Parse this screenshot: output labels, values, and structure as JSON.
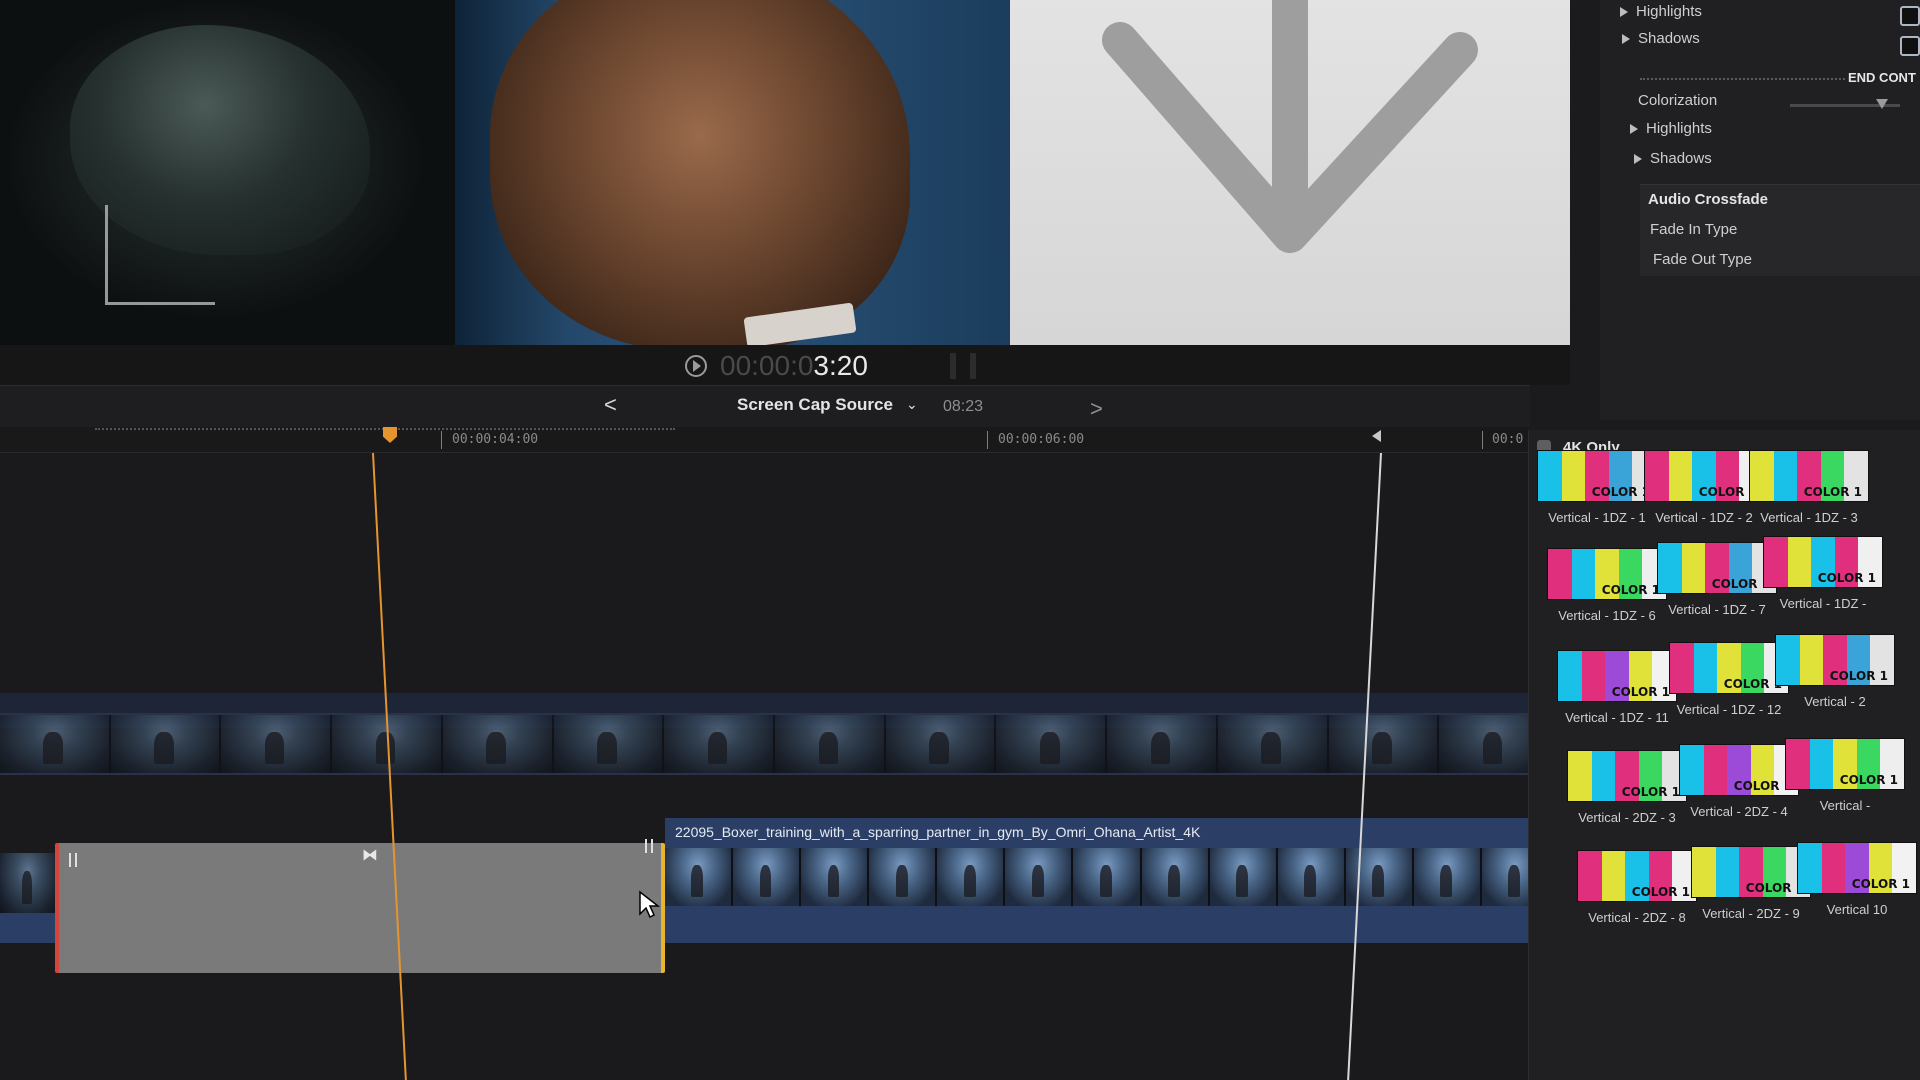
{
  "viewer": {
    "timecode_dim": "00:00:0",
    "timecode_bright": "3:20"
  },
  "inspector": {
    "rows": [
      "Highlights",
      "Shadows",
      "Colorization",
      "Highlights",
      "Shadows"
    ],
    "end_label": "END CONT",
    "audio_title": "Audio Crossfade",
    "fade_in": "Fade In Type",
    "fade_out": "Fade Out Type"
  },
  "timeline_header": {
    "project_name": "Screen Cap Source",
    "duration": "08:23",
    "prev": "<",
    "next": ">",
    "chevron": "⌄"
  },
  "ruler": {
    "labels": [
      "00:00:04:00",
      "00:00:06:00",
      "00:0"
    ]
  },
  "timeline": {
    "clip_name": "22095_Boxer_training_with_a_sparring_partner_in_gym_By_Omri_Ohana_Artist_4K"
  },
  "browser": {
    "filter_label": "4K Only",
    "thumb_text": "COLOR 1",
    "tiles": [
      {
        "name": "Vertical - 1DZ - 1"
      },
      {
        "name": "Vertical - 1DZ - 2"
      },
      {
        "name": "Vertical - 1DZ - 3"
      },
      {
        "name": "Vertical - 1DZ - 6"
      },
      {
        "name": "Vertical - 1DZ - 7"
      },
      {
        "name": "Vertical - 1DZ -"
      },
      {
        "name": "Vertical - 1DZ - 11"
      },
      {
        "name": "Vertical - 1DZ - 12"
      },
      {
        "name": "Vertical - 2"
      },
      {
        "name": "Vertical - 2DZ - 3"
      },
      {
        "name": "Vertical - 2DZ - 4"
      },
      {
        "name": "Vertical -"
      },
      {
        "name": "Vertical - 2DZ - 8"
      },
      {
        "name": "Vertical - 2DZ - 9"
      },
      {
        "name": "Vertical 10"
      }
    ]
  },
  "colors": {
    "playhead": "#e4952f",
    "clip_blue": "#2b3f66",
    "gap_gray": "#7a7a7b",
    "trim_red": "#d6453a",
    "trim_yellow": "#e7b52e"
  }
}
